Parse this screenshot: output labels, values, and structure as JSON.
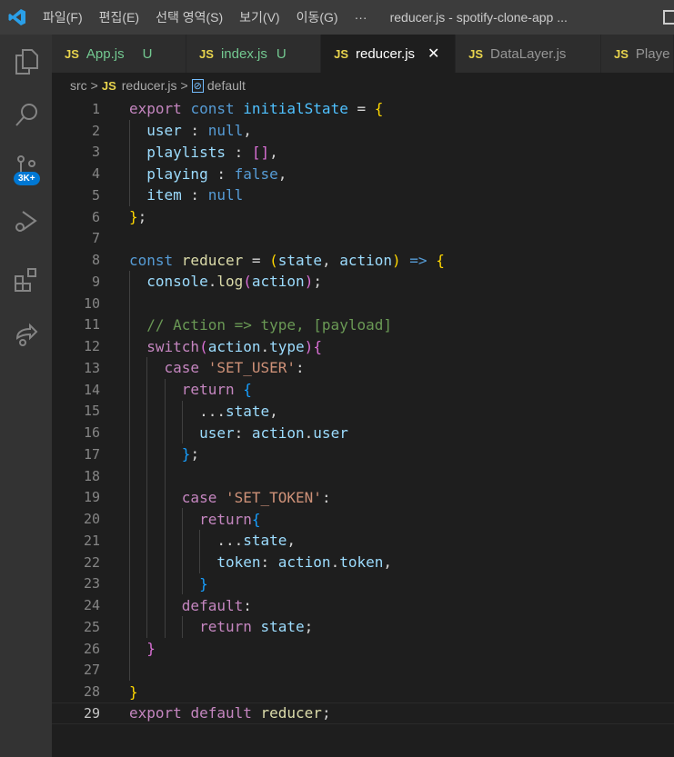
{
  "titlebar": {
    "menus": [
      "파일(F)",
      "편집(E)",
      "선택 영역(S)",
      "보기(V)",
      "이동(G)",
      "···"
    ],
    "title": "reducer.js - spotify-clone-app ..."
  },
  "activity": {
    "badge": "3K+"
  },
  "tabs": [
    {
      "label": "App.js",
      "status": "U",
      "lang": "JS"
    },
    {
      "label": "index.js",
      "status": "U",
      "lang": "JS"
    },
    {
      "label": "reducer.js",
      "close": "✕",
      "lang": "JS",
      "active": true
    },
    {
      "label": "DataLayer.js",
      "lang": "JS"
    },
    {
      "label": "Playe",
      "lang": "JS"
    }
  ],
  "breadcrumb": {
    "folder": "src",
    "sep": ">",
    "lang": "JS",
    "file": "reducer.js",
    "symbol": "default"
  },
  "lines": [
    {
      "n": "1",
      "i": 0,
      "t": [
        [
          "export ",
          "kw"
        ],
        [
          "const ",
          "st"
        ],
        [
          "initialState",
          "var"
        ],
        [
          " = ",
          "p"
        ],
        [
          "{",
          "b1"
        ]
      ]
    },
    {
      "n": "2",
      "i": 1,
      "t": [
        [
          "user",
          "prop"
        ],
        [
          " : ",
          "p"
        ],
        [
          "null",
          "st"
        ],
        [
          ",",
          "p"
        ]
      ]
    },
    {
      "n": "3",
      "i": 1,
      "t": [
        [
          "playlists",
          "prop"
        ],
        [
          " : ",
          "p"
        ],
        [
          "[]",
          "b2"
        ],
        [
          ",",
          "p"
        ]
      ]
    },
    {
      "n": "4",
      "i": 1,
      "t": [
        [
          "playing",
          "prop"
        ],
        [
          " : ",
          "p"
        ],
        [
          "false",
          "st"
        ],
        [
          ",",
          "p"
        ]
      ]
    },
    {
      "n": "5",
      "i": 1,
      "t": [
        [
          "item",
          "prop"
        ],
        [
          " : ",
          "p"
        ],
        [
          "null",
          "st"
        ]
      ]
    },
    {
      "n": "6",
      "i": 0,
      "t": [
        [
          "}",
          "b1"
        ],
        [
          ";",
          "p"
        ]
      ]
    },
    {
      "n": "7",
      "i": 0,
      "t": []
    },
    {
      "n": "8",
      "i": 0,
      "t": [
        [
          "const ",
          "st"
        ],
        [
          "reducer",
          "fn"
        ],
        [
          " = ",
          "p"
        ],
        [
          "(",
          "b1"
        ],
        [
          "state",
          "prop"
        ],
        [
          ", ",
          "p"
        ],
        [
          "action",
          "prop"
        ],
        [
          ")",
          "b1"
        ],
        [
          " => ",
          "st"
        ],
        [
          "{",
          "b1"
        ]
      ]
    },
    {
      "n": "9",
      "i": 1,
      "t": [
        [
          "console",
          "prop"
        ],
        [
          ".",
          "p"
        ],
        [
          "log",
          "fn"
        ],
        [
          "(",
          "b2"
        ],
        [
          "action",
          "prop"
        ],
        [
          ")",
          "b2"
        ],
        [
          ";",
          "p"
        ]
      ]
    },
    {
      "n": "10",
      "i": 1,
      "t": []
    },
    {
      "n": "11",
      "i": 1,
      "t": [
        [
          "// Action => type, [payload]",
          "cm"
        ]
      ]
    },
    {
      "n": "12",
      "i": 1,
      "t": [
        [
          "switch",
          "kw"
        ],
        [
          "(",
          "b2"
        ],
        [
          "action",
          "prop"
        ],
        [
          ".",
          "p"
        ],
        [
          "type",
          "prop"
        ],
        [
          ")",
          "b2"
        ],
        [
          "{",
          "b2"
        ]
      ]
    },
    {
      "n": "13",
      "i": 2,
      "t": [
        [
          "case ",
          "kw"
        ],
        [
          "'SET_USER'",
          "str"
        ],
        [
          ":",
          "p"
        ]
      ]
    },
    {
      "n": "14",
      "i": 3,
      "t": [
        [
          "return ",
          "kw"
        ],
        [
          "{",
          "b3"
        ]
      ]
    },
    {
      "n": "15",
      "i": 4,
      "t": [
        [
          "...",
          "p"
        ],
        [
          "state",
          "prop"
        ],
        [
          ",",
          "p"
        ]
      ]
    },
    {
      "n": "16",
      "i": 4,
      "t": [
        [
          "user",
          "prop"
        ],
        [
          ": ",
          "p"
        ],
        [
          "action",
          "prop"
        ],
        [
          ".",
          "p"
        ],
        [
          "user",
          "prop"
        ]
      ]
    },
    {
      "n": "17",
      "i": 3,
      "t": [
        [
          "}",
          "b3"
        ],
        [
          ";",
          "p"
        ]
      ]
    },
    {
      "n": "18",
      "i": 3,
      "t": []
    },
    {
      "n": "19",
      "i": 3,
      "t": [
        [
          "case ",
          "kw"
        ],
        [
          "'SET_TOKEN'",
          "str"
        ],
        [
          ":",
          "p"
        ]
      ]
    },
    {
      "n": "20",
      "i": 4,
      "t": [
        [
          "return",
          "kw"
        ],
        [
          "{",
          "b3"
        ]
      ]
    },
    {
      "n": "21",
      "i": 5,
      "t": [
        [
          "...",
          "p"
        ],
        [
          "state",
          "prop"
        ],
        [
          ",",
          "p"
        ]
      ]
    },
    {
      "n": "22",
      "i": 5,
      "t": [
        [
          "token",
          "prop"
        ],
        [
          ": ",
          "p"
        ],
        [
          "action",
          "prop"
        ],
        [
          ".",
          "p"
        ],
        [
          "token",
          "prop"
        ],
        [
          ",",
          "p"
        ]
      ]
    },
    {
      "n": "23",
      "i": 4,
      "t": [
        [
          "}",
          "b3"
        ]
      ]
    },
    {
      "n": "24",
      "i": 3,
      "t": [
        [
          "default",
          "kw"
        ],
        [
          ":",
          "p"
        ]
      ]
    },
    {
      "n": "25",
      "i": 4,
      "t": [
        [
          "return ",
          "kw"
        ],
        [
          "state",
          "prop"
        ],
        [
          ";",
          "p"
        ]
      ]
    },
    {
      "n": "26",
      "i": 1,
      "t": [
        [
          "}",
          "b2"
        ]
      ]
    },
    {
      "n": "27",
      "i": 1,
      "t": []
    },
    {
      "n": "28",
      "i": 0,
      "t": [
        [
          "}",
          "b1"
        ]
      ]
    },
    {
      "n": "29",
      "i": 0,
      "t": [
        [
          "export ",
          "kw"
        ],
        [
          "default ",
          "kw"
        ],
        [
          "reducer",
          "fn"
        ],
        [
          ";",
          "p"
        ]
      ],
      "current": true
    }
  ]
}
